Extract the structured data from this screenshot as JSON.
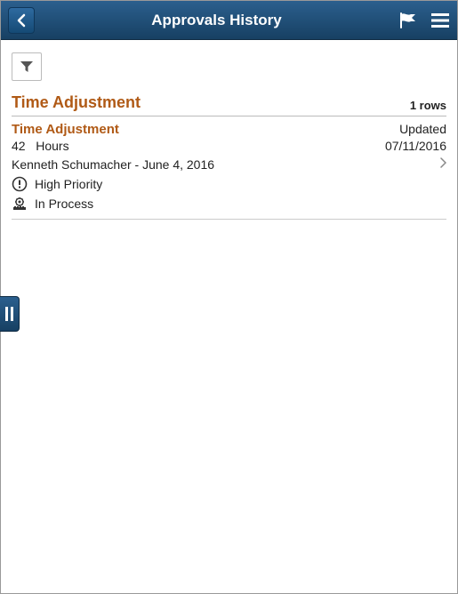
{
  "header": {
    "title": "Approvals History"
  },
  "section": {
    "title": "Time Adjustment",
    "rows_label": "1 rows"
  },
  "item": {
    "title": "Time Adjustment",
    "status": "Updated",
    "quantity": "42",
    "unit": "Hours",
    "status_date": "07/11/2016",
    "submitter_line": "Kenneth Schumacher - June 4, 2016",
    "priority_label": "High Priority",
    "state_label": "In Process"
  }
}
